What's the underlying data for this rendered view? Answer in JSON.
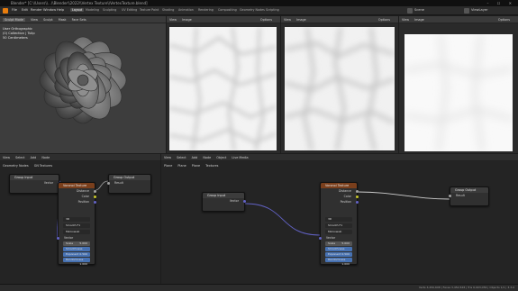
{
  "title_bar": {
    "title": "Blender* [C:\\\\Users\\\\...\\\\Blender\\\\2022\\\\Vertex Texture\\\\VertexTexture.blend]",
    "controls": "– ☐ ✕"
  },
  "menubar": {
    "file": "File",
    "edit": "Edit",
    "render": "Render",
    "window": "Window",
    "help": "Help",
    "workspaces": [
      "Layout",
      "Modeling",
      "Sculpting",
      "UV Editing",
      "Texture Paint",
      "Shading",
      "Animation",
      "Rendering",
      "Compositing",
      "Geometry Nodes",
      "Scripting"
    ],
    "active_workspace": "Layout",
    "scene_label": "Scene",
    "view_layer_label": "ViewLayer"
  },
  "viewport": {
    "mode": "Sculpt Mode",
    "menus": [
      "View",
      "Sculpt",
      "Mask",
      "Face Sets"
    ],
    "overlay_lines": [
      "User Orthographic",
      "(0) Collection | Tulip",
      "50 Centimeters"
    ]
  },
  "image_editors": [
    {
      "menus": [
        "View",
        "Image"
      ],
      "options": "Options"
    },
    {
      "menus": [
        "View",
        "Image"
      ],
      "options": "Options"
    },
    {
      "menus": [
        "View",
        "Image"
      ],
      "options": "Options"
    }
  ],
  "node_left": {
    "editor": "Geometry Nodes",
    "breadcrumb": "GN Textures",
    "header_menus": [
      "View",
      "Select",
      "Add",
      "Node"
    ],
    "nodes": {
      "group_input": {
        "title": "Group Input",
        "socket": "Vector"
      },
      "voronoi": {
        "title": "Voronoi Texture",
        "outputs": [
          "Distance",
          "Color",
          "Position"
        ],
        "dimension": "3D",
        "feature": "Smooth F1",
        "metric": "Minkowski",
        "vector_label": "Vector",
        "fields": [
          {
            "label": "Scale",
            "value": "5.000"
          },
          {
            "label": "Smoothness",
            "value": "1.000"
          },
          {
            "label": "Exponent",
            "value": "0.500"
          },
          {
            "label": "Randomness",
            "value": "1.000"
          }
        ]
      },
      "group_output": {
        "title": "Group Output",
        "socket": "Result"
      }
    }
  },
  "node_right": {
    "object_label": "Object",
    "live_label": "Live Media",
    "breadcrumb": [
      "Plane",
      "Plane",
      "Plane",
      "Textures"
    ],
    "header_menus": [
      "View",
      "Select",
      "Add",
      "Node"
    ],
    "nodes": {
      "group_input": {
        "title": "Group Input",
        "socket": "Vector"
      },
      "voronoi": {
        "title": "Voronoi Texture",
        "outputs": [
          "Distance",
          "Color",
          "Position"
        ],
        "dimension": "3D",
        "feature": "Smooth F1",
        "metric": "Minkowski",
        "vector_label": "Vector",
        "fields": [
          {
            "label": "Scale",
            "value": "5.000"
          },
          {
            "label": "Smoothness",
            "value": "1.000"
          },
          {
            "label": "Exponent",
            "value": "0.500"
          },
          {
            "label": "Randomness",
            "value": "1.000"
          }
        ]
      },
      "group_output": {
        "title": "Group Output",
        "socket": "Result"
      }
    }
  },
  "statusbar": {
    "right_text": "Verts 3,450,608 | Faces 3,452,528 | Tris 6,903,056 | Objects 1/1 | 3.3.0"
  },
  "colors": {
    "texture_header": "#7a3f1c",
    "link_purple": "#6363c7",
    "socket_grey": "#a1a1a1",
    "socket_yellow": "#c7c729",
    "socket_purple": "#6363c7",
    "field_blue": "#4772b3"
  }
}
